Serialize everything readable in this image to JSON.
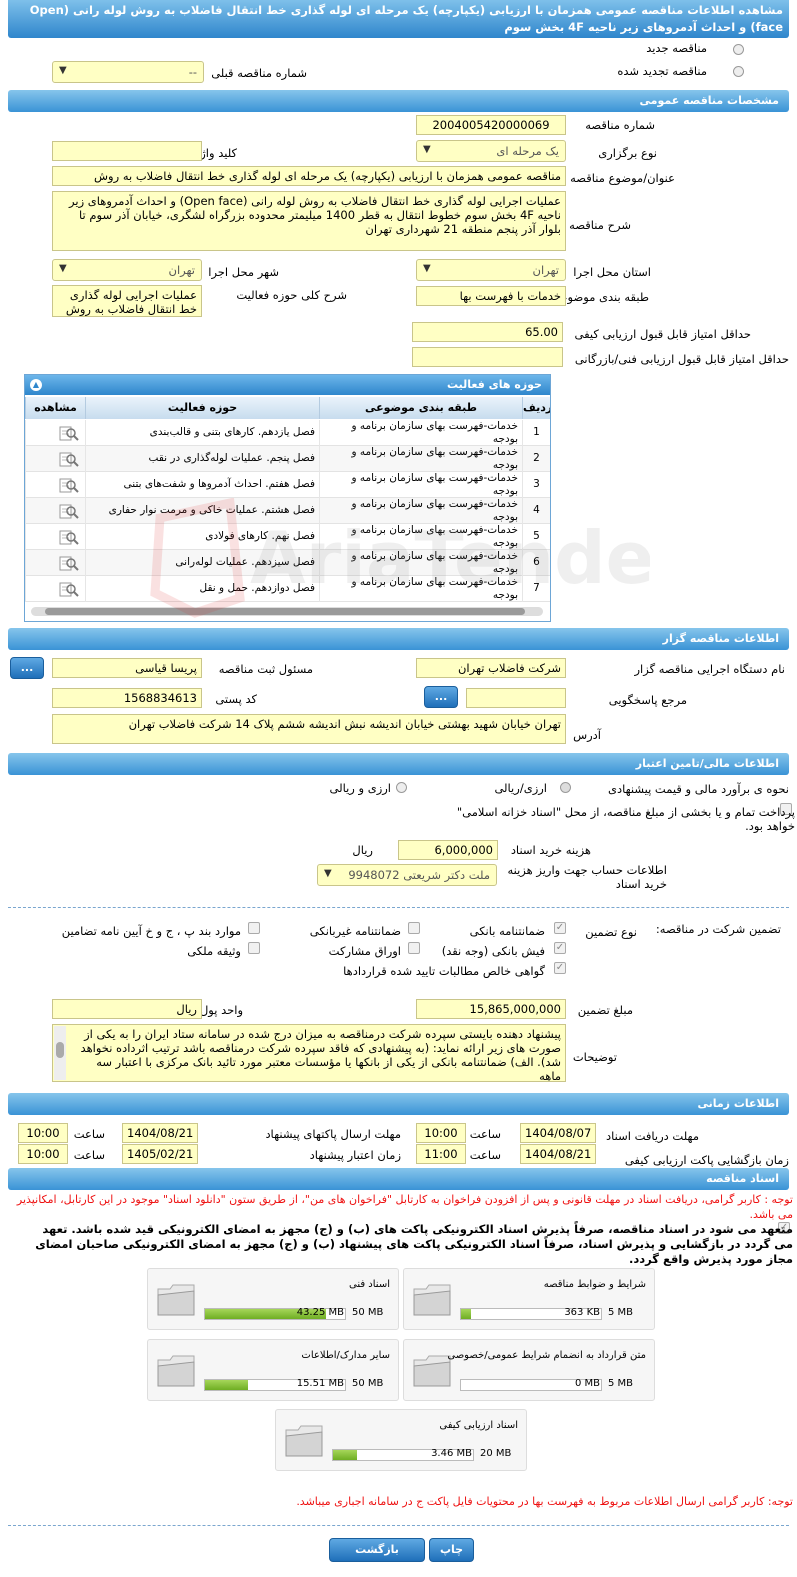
{
  "page_title": "مشاهده اطلاعات مناقصه عمومی همزمان با ارزیابی (یکپارچه) یک مرحله ای لوله گذاری خط انتقال فاضلاب به روش لوله رانی (Open face) و احداث آدمروهای زیر ناحیه 4F بخش سوم",
  "top": {
    "new_label": "مناقصه جدید",
    "renewed_label": "مناقصه تجدید شده",
    "prev_label": "شماره مناقصه قبلی",
    "prev_value": "--"
  },
  "general": {
    "header": "مشخصات مناقصه عمومی",
    "number_label": "شماره مناقصه",
    "number_value": "2004005420000069",
    "type_label": "نوع برگزاری",
    "type_value": "یک مرحله ای",
    "keyword_label": "کلید واژه",
    "keyword_value": "",
    "subject_label": "عنوان/موضوع مناقصه",
    "subject_value": "مناقصه عمومی همزمان با ارزیابی (یکپارچه) یک مرحله ای لوله گذاری خط انتقال فاضلاب به روش",
    "desc_label": "شرح مناقصه",
    "desc_value": "عملیات اجرایی لوله گذاری خط انتقال فاضلاب به روش لوله رانی (Open face) و احداث آدمروهای زیر ناحیه 4F بخش سوم خطوط انتقال به قطر 1400 میلیمتر محدوده بزرگراه لشگری، خیابان آذر سوم تا بلوار آذر پنجم منطقه 21 شهرداری تهران",
    "province_label": "استان محل اجرا",
    "province_value": "تهران",
    "city_label": "شهر محل اجرا",
    "city_value": "تهران",
    "category_label": "طبقه بندی موضوعی",
    "category_value": "خدمات با فهرست بها",
    "scope_label": "شرح کلی حوزه فعالیت",
    "scope_value": "عملیات اجرایی لوله گذاری خط انتقال فاضلاب به روش",
    "min_quality_label": "حداقل امتیاز قابل قبول ارزیابی کیفی",
    "min_quality_value": "65.00",
    "min_tech_label": "حداقل امتیاز قابل قبول ارزیابی فنی/بازرگانی",
    "min_tech_value": ""
  },
  "activity": {
    "header": "حوزه های فعالیت",
    "col_row": "ردیف",
    "col_category": "طبقه بندی موضوعی",
    "col_activity": "حوزه فعالیت",
    "col_view": "مشاهده",
    "rows": [
      {
        "n": "1",
        "cat": "خدمات-فهرست بهای سازمان برنامه و بودجه",
        "act": "فصل یازدهم. کارهای بتنی و قالب‌بندی"
      },
      {
        "n": "2",
        "cat": "خدمات-فهرست بهای سازمان برنامه و بودجه",
        "act": "فصل پنجم. عملیات لوله‌گذاری در نقب"
      },
      {
        "n": "3",
        "cat": "خدمات-فهرست بهای سازمان برنامه و بودجه",
        "act": "فصل هفتم. احداث آدمروها و شفت‌های بتنی"
      },
      {
        "n": "4",
        "cat": "خدمات-فهرست بهای سازمان برنامه و بودجه",
        "act": "فصل هشتم. عملیات خاکی و مرمت نوار حفاری"
      },
      {
        "n": "5",
        "cat": "خدمات-فهرست بهای سازمان برنامه و بودجه",
        "act": "فصل نهم. کارهای فولادی"
      },
      {
        "n": "6",
        "cat": "خدمات-فهرست بهای سازمان برنامه و بودجه",
        "act": "فصل سیزدهم. عملیات لوله‌رانی"
      },
      {
        "n": "7",
        "cat": "خدمات-فهرست بهای سازمان برنامه و بودجه",
        "act": "فصل دوازدهم. حمل و نقل"
      }
    ]
  },
  "organizer": {
    "header": "اطلاعات مناقصه گزار",
    "org_label": "نام دستگاه اجرایی مناقصه گزار",
    "org_value": "شرکت فاضلاب تهران",
    "resp_label": "مسئول ثبت مناقصه",
    "resp_value": "پریسا قیاسی",
    "ref_label": "مرجع پاسخگویی",
    "ref_value": "",
    "postal_label": "کد پستی",
    "postal_value": "1568834613",
    "addr_label": "آدرس",
    "addr_value": "تهران خیابان شهید بهشتی خیابان اندیشه نبش اندیشه ششم پلاک 14 شرکت فاضلاب تهران",
    "more": "..."
  },
  "finance": {
    "header": "اطلاعات مالی/تامین اعتبار",
    "estimate_label": "نحوه ی برآورد مالی و قیمت پیشنهادی",
    "opt_currency": "ارزی/ریالی",
    "opt_rial": "ارزی و ریالی",
    "treasury_label": "پرداخت تمام و یا بخشی از مبلغ مناقصه، از محل \"اسناد خزانه اسلامی\" خواهد بود.",
    "doc_cost_label": "هزینه خرید اسناد",
    "doc_cost_value": "6,000,000",
    "doc_cost_unit": "ریال",
    "account_label": "اطلاعات حساب جهت واریز هزینه خرید اسناد",
    "account_value": "ملت دکتر شریعتی 9948072"
  },
  "guarantee": {
    "title": "تضمین شرکت در مناقصه:",
    "type_label": "نوع تضمین",
    "bank": "ضمانتنامه بانکی",
    "nonbank": "ضمانتنامه غیربانکی",
    "clause": "موارد بند پ ، ج و خ آیین نامه تضامین",
    "check": "فیش بانکی (وجه نقد)",
    "bonds": "اوراق مشارکت",
    "property": "وثیقه ملکی",
    "receivables": "گواهی خالص مطالبات تایید شده قراردادها",
    "amount_label": "مبلغ تضمین",
    "amount_value": "15,865,000,000",
    "unit_label": "واحد پول",
    "unit_value": "ریال",
    "notes_label": "توضیحات",
    "notes_value": "پیشنهاد دهنده بایستی سپرده شرکت درمناقصه به میزان درج شده در سامانه ستاد ایران را به یکی از صورت های زیر ارائه نماید: (به پیشنهادی که فاقد سپرده شرکت درمناقصه باشد ترتیب اثرداده نخواهد شد). الف) ضمانتنامه بانکی از یکی از بانکها یا مؤسسات معتبر مورد تائید بانک مرکزی با اعتبار سه ماهه"
  },
  "timing": {
    "header": "اطلاعات زمانی",
    "doc_deadline_label": "مهلت دریافت اسناد",
    "doc_deadline_date": "1404/08/07",
    "doc_deadline_time": "10:00",
    "send_deadline_label": "مهلت ارسال پاکتهای پیشنهاد",
    "send_deadline_date": "1404/08/21",
    "send_deadline_time": "10:00",
    "open_label": "زمان بازگشایی پاکت ارزیابی کیفی",
    "open_date": "1404/08/21",
    "open_time": "11:00",
    "validity_label": "زمان اعتبار پیشنهاد",
    "validity_date": "1405/02/21",
    "validity_time": "10:00",
    "time_label": "ساعت"
  },
  "docs": {
    "header": "اسناد مناقصه",
    "notice": "توجه : کاربر گرامی، دریافت اسناد در مهلت قانونی و پس از افزودن فراخوان به کارتابل \"فراخوان های من\"، از طریق ستون \"دانلود اسناد\" موجود در این کارتابل، امکانپذیر می باشد.",
    "commit": "متعهد می شود در اسناد مناقصه، صرفاً پذیرش اسناد الکترونیکی پاکت های (ب) و (ج) مجهز به امضای الکترونیکی قید شده باشد. تعهد می گردد در بازگشایی و پذیرش اسناد، صرفاً اسناد الکترونیکی پاکت های پیشنهاد (ب) و (ج) مجهز به امضای الکترونیکی صاحبان امضای مجاز مورد پذیرش واقع گردد.",
    "cards": [
      {
        "title": "شرایط و ضوابط مناقصه",
        "used": "363 KB",
        "max": "5 MB",
        "fill": 0.07
      },
      {
        "title": "اسناد فنی",
        "used": "43.25 MB",
        "max": "50 MB",
        "fill": 0.865
      },
      {
        "title": "متن قرارداد به انضمام شرایط عمومی/خصوصی",
        "used": "0 MB",
        "max": "5 MB",
        "fill": 0.0
      },
      {
        "title": "سایر مدارک/اطلاعات",
        "used": "15.51 MB",
        "max": "50 MB",
        "fill": 0.31
      },
      {
        "title": "اسناد ارزیابی کیفی",
        "used": "3.46 MB",
        "max": "20 MB",
        "fill": 0.173
      }
    ],
    "footer_note": "توجه: کاربر گرامی ارسال اطلاعات مربوط به فهرست بها در محتویات فایل پاکت ج در سامانه اجباری میباشد."
  },
  "buttons": {
    "print": "چاپ",
    "back": "بازگشت"
  },
  "watermark": "AriaTender.neT",
  "colors": {
    "header_blue": "#3a93d6",
    "field_yellow": "#ffffc4",
    "notice_red": "#e11111",
    "progress_green": "#7ab82e"
  }
}
